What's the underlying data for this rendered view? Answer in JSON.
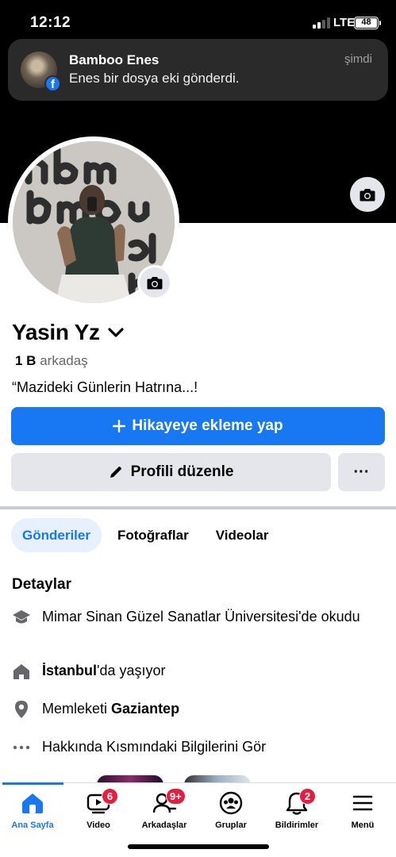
{
  "status_bar": {
    "time": "12:12",
    "network": "LTE",
    "battery": "48"
  },
  "notification": {
    "sender": "Bamboo Enes",
    "message": "Enes bir dosya eki gönderdi.",
    "time": "şimdi"
  },
  "profile": {
    "name": "Yasin Yz",
    "friends_count": "1 B",
    "friends_label": "arkadaş",
    "bio": "“Mazideki Günlerin Hatrına...!"
  },
  "buttons": {
    "add_story": "Hikayeye ekleme yap",
    "edit_profile": "Profili düzenle",
    "more": "···"
  },
  "tabs": [
    {
      "label": "Gönderiler",
      "active": true
    },
    {
      "label": "Fotoğraflar",
      "active": false
    },
    {
      "label": "Videolar",
      "active": false
    }
  ],
  "details": {
    "title": "Detaylar",
    "education": "Mimar Sinan Güzel Sanatlar Üniversitesi'de okudu",
    "lives_in_city": "İstanbul",
    "lives_in_suffix": "'da yaşıyor",
    "hometown_prefix": "Memleketi",
    "hometown_city": "Gaziantep",
    "about_link": "Hakkında Kısmındaki Bilgilerini Gör"
  },
  "bottom_nav": [
    {
      "label": "Ana Sayfa",
      "icon": "home-icon",
      "badge": ""
    },
    {
      "label": "Video",
      "icon": "video-icon",
      "badge": "6"
    },
    {
      "label": "Arkadaşlar",
      "icon": "friends-icon",
      "badge": "9+"
    },
    {
      "label": "Gruplar",
      "icon": "groups-icon",
      "badge": ""
    },
    {
      "label": "Bildirimler",
      "icon": "bell-icon",
      "badge": "2"
    },
    {
      "label": "Menü",
      "icon": "menu-icon",
      "badge": ""
    }
  ],
  "colors": {
    "primary": "#1877f2",
    "badge": "#e41e3f",
    "secondary_button": "#e4e6eb"
  }
}
